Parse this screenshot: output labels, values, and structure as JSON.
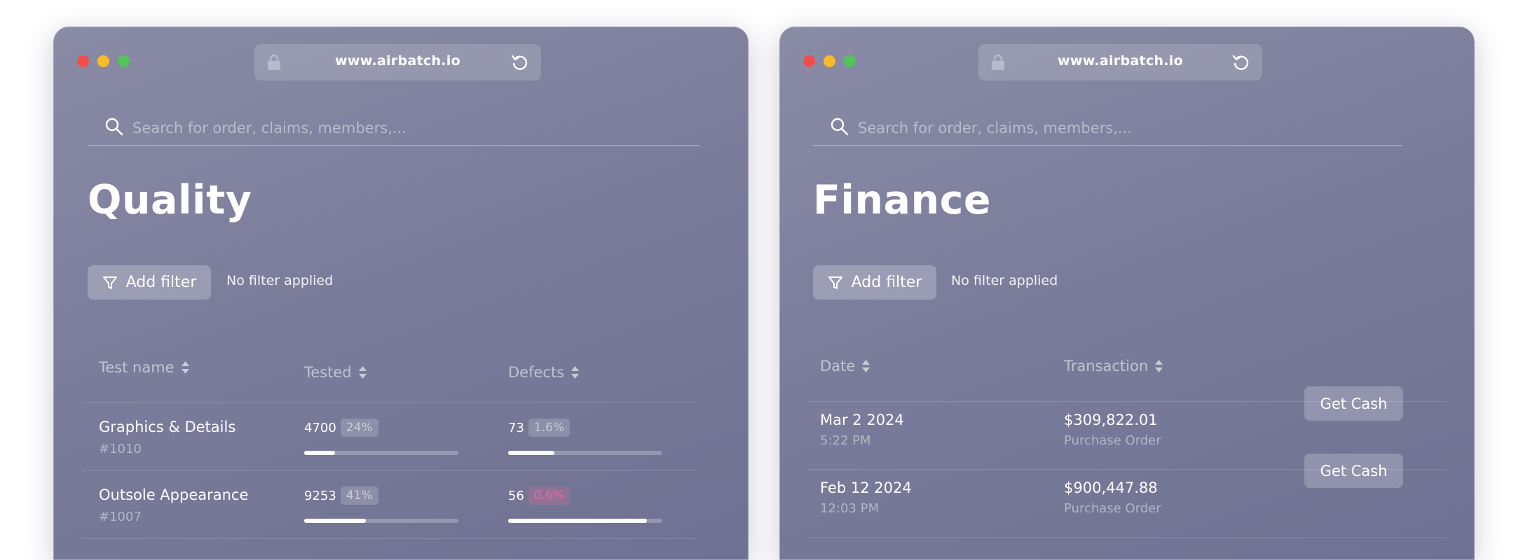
{
  "quality": {
    "url": "www.airbatch.io",
    "search_placeholder": "Search for order, claims, members,...",
    "title": "Quality",
    "filter_label": "Add filter",
    "filter_status": "No filter applied",
    "columns": [
      "Test name",
      "Tested",
      "Defects"
    ],
    "rows": [
      {
        "name": "Graphics & Details",
        "id": "#1010",
        "tested": "4700",
        "tested_pct": "24%",
        "tested_progress": 0.2,
        "defects": "73",
        "defects_pct": "1.6%",
        "defects_progress": 0.3
      },
      {
        "name": "Outsole Appearance",
        "id": "#1007",
        "tested": "9253",
        "tested_pct": "41%",
        "tested_progress": 0.4,
        "defects": "56",
        "defects_pct": "0.6%",
        "defects_progress": 0.9
      }
    ]
  },
  "finance": {
    "url": "www.airbatch.io",
    "search_placeholder": "Search for order, claims, members,...",
    "title": "Finance",
    "filter_label": "Add filter",
    "filter_status": "No filter applied",
    "columns": [
      "Date",
      "Transaction"
    ],
    "rows": [
      {
        "date": "Mar 2 2024",
        "time": "5:22 PM",
        "amount": "$309,822.01",
        "type": "Purchase Order",
        "action": "Get Cash"
      },
      {
        "date": "Feb 12 2024",
        "time": "12:03 PM",
        "amount": "$900,447.88",
        "type": "Purchase Order",
        "action": "Get Cash"
      }
    ]
  },
  "colors": {
    "window_bg": "#7c7e9c",
    "alert": "#e86aa0",
    "dot_red": "#f04e4e",
    "dot_yellow": "#f5bb2c",
    "dot_green": "#52c45a"
  }
}
